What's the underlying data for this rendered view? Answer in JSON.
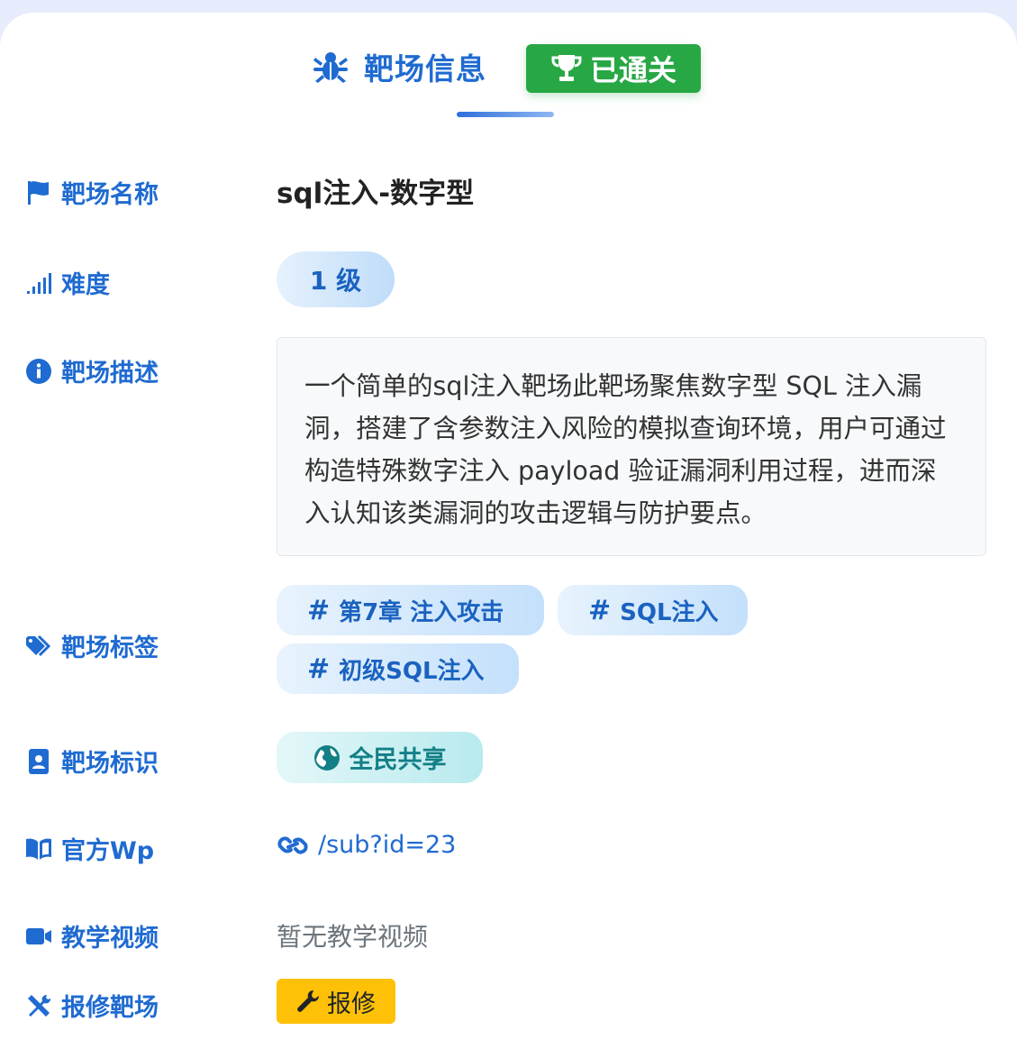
{
  "header": {
    "title": "靶场信息",
    "status_badge": "已通关"
  },
  "colors": {
    "accent": "#1f6bd1",
    "success": "#28a745",
    "warning": "#ffc107",
    "teal": "#137f86"
  },
  "fields": {
    "name": {
      "label": "靶场名称",
      "icon": "flag-icon",
      "value": "sql注入-数字型"
    },
    "difficulty": {
      "label": "难度",
      "icon": "signal-bars-icon",
      "value": "1 级"
    },
    "description": {
      "label": "靶场描述",
      "icon": "info-circle-icon",
      "value": "一个简单的sql注入靶场此靶场聚焦数字型 SQL 注入漏洞，搭建了含参数注入风险的模拟查询环境，用户可通过构造特殊数字注入 payload 验证漏洞利用过程，进而深入认知该类漏洞的攻击逻辑与防护要点。"
    },
    "tags": {
      "label": "靶场标签",
      "icon": "tags-icon",
      "items": [
        "第7章 注入攻击",
        "SQL注入",
        "初级SQL注入"
      ],
      "prefix": "#"
    },
    "identity": {
      "label": "靶场标识",
      "icon": "id-badge-icon",
      "value": "全民共享",
      "value_icon": "globe-icon"
    },
    "wp": {
      "label": "官方Wp",
      "icon": "book-open-icon",
      "link": "/sub?id=23",
      "link_icon": "link-icon"
    },
    "video": {
      "label": "教学视频",
      "icon": "video-camera-icon",
      "value": "暂无教学视频"
    },
    "repair": {
      "label": "报修靶场",
      "icon": "tools-icon",
      "button": "报修",
      "button_icon": "wrench-icon"
    }
  }
}
